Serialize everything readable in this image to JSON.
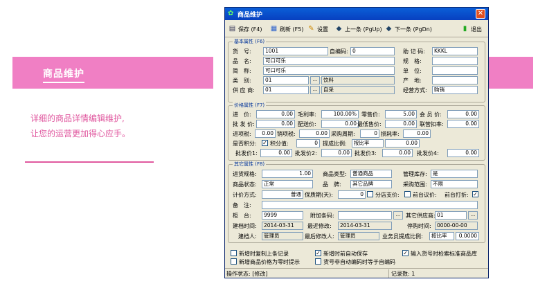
{
  "promo": {
    "title": "商品维护",
    "line1": "详细的商品详情编辑维护,",
    "line2": "让您的运营更加得心应手。"
  },
  "window": {
    "title": "商品维护"
  },
  "toolbar": {
    "save": "保存 (F4)",
    "refresh": "刷新 (F5)",
    "settings": "设置",
    "prev": "上一条 (PgUp)",
    "next": "下一条 (PgDn)",
    "exit": "退出"
  },
  "basic": {
    "legend": "基本属性 (F6)",
    "l_code": "货　号:",
    "code": "1001",
    "l_autocode": "自编码:",
    "autocode": "0",
    "l_mnemonic": "助 记 码:",
    "mnemonic": "KKKL",
    "l_name": "品　名:",
    "name": "可口可乐",
    "l_spec": "规　格:",
    "spec": "",
    "l_short": "简　称:",
    "short": "可口可乐",
    "l_unit": "单　位:",
    "unit": "",
    "l_cat": "类　别:",
    "cat": "01",
    "cat_name": "饮料",
    "l_origin": "产　地:",
    "origin": "",
    "l_supplier": "供 应 商:",
    "supplier": "01",
    "supplier_name": "自采",
    "l_mode": "经营方式:",
    "mode": "购销"
  },
  "price": {
    "legend": "价格属性 (F7)",
    "l_buy": "进　价:",
    "buy": "0.00",
    "l_margin": "毛利率:",
    "margin": "100.00%",
    "l_retail": "零售价:",
    "retail": "5.00",
    "l_member": "会 员 价:",
    "member": "0.00",
    "l_whole": "批 发 价:",
    "whole": "0.00",
    "l_dist": "配送价:",
    "dist": "0.00",
    "l_min": "最低售价:",
    "min": "0.00",
    "l_chain": "联营扣率:",
    "chain": "0.00",
    "l_intax": "进项税:",
    "intax": "0.00",
    "l_outtax": "销项税:",
    "outtax": "0.00",
    "l_cycle": "采购周期:",
    "cycle": "0",
    "l_loss": "损耗率:",
    "loss": "0.00",
    "l_points": "是否积分:",
    "l_pointval": "积分值:",
    "pointval": "0",
    "l_ratio": "提成比例:",
    "ratio": "按比率",
    "ratioval": "0.00",
    "l_wp1": "批发价1:",
    "wp1": "0.00",
    "l_wp2": "批发价2:",
    "wp2": "0.00",
    "l_wp3": "批发价3:",
    "wp3": "0.00",
    "l_wp4": "批发价4:",
    "wp4": "0.00"
  },
  "other": {
    "legend": "其它属性 (F8)",
    "l_inspec": "进货规格:",
    "inspec": "1.00",
    "l_type": "商品类型:",
    "type": "普通商品",
    "l_stock": "管理库存:",
    "stock": "是",
    "l_status": "商品状态:",
    "status": "正常",
    "l_brand": "品　牌:",
    "brand": "其它品牌",
    "l_scope": "采购范围:",
    "scope": "不限",
    "l_pricing": "计价方式:",
    "pricing": "普通",
    "l_shelf": "保质期(天):",
    "shelf": "0",
    "l_split": "分店支价:",
    "l_deskpr": "前台议价:",
    "l_deskdisc": "前台打折:",
    "l_note": "备　注:",
    "note": "",
    "l_counter": "柜　台:",
    "counter": "9999",
    "l_addcode": "附加条码:",
    "addcode": "",
    "l_osupp": "其它供应商:",
    "osupp": "01",
    "l_created": "建档时间:",
    "created": "2014-03-31",
    "l_modified": "最近修改:",
    "modified": "2014-03-31",
    "l_stopped": "停购时间:",
    "stopped": "0000-00-00",
    "l_creator": "建档人:",
    "creator": "管理员",
    "l_lastmod": "最后修改人:",
    "lastmod": "管理员",
    "l_salescomm": "业务员提成比例:",
    "salescomm": "按比率",
    "salescommval": "0.0000"
  },
  "options": {
    "o1": "新增时复制上条记录",
    "o2": "新增时前自动保存",
    "o3": "输入货号时检索标准商品库",
    "o4": "新增商品价格为零时提示",
    "o5": "货号非自动编码时等于自编码"
  },
  "status": {
    "state": "操作状态: [修改]",
    "count": "记录数: 1"
  }
}
